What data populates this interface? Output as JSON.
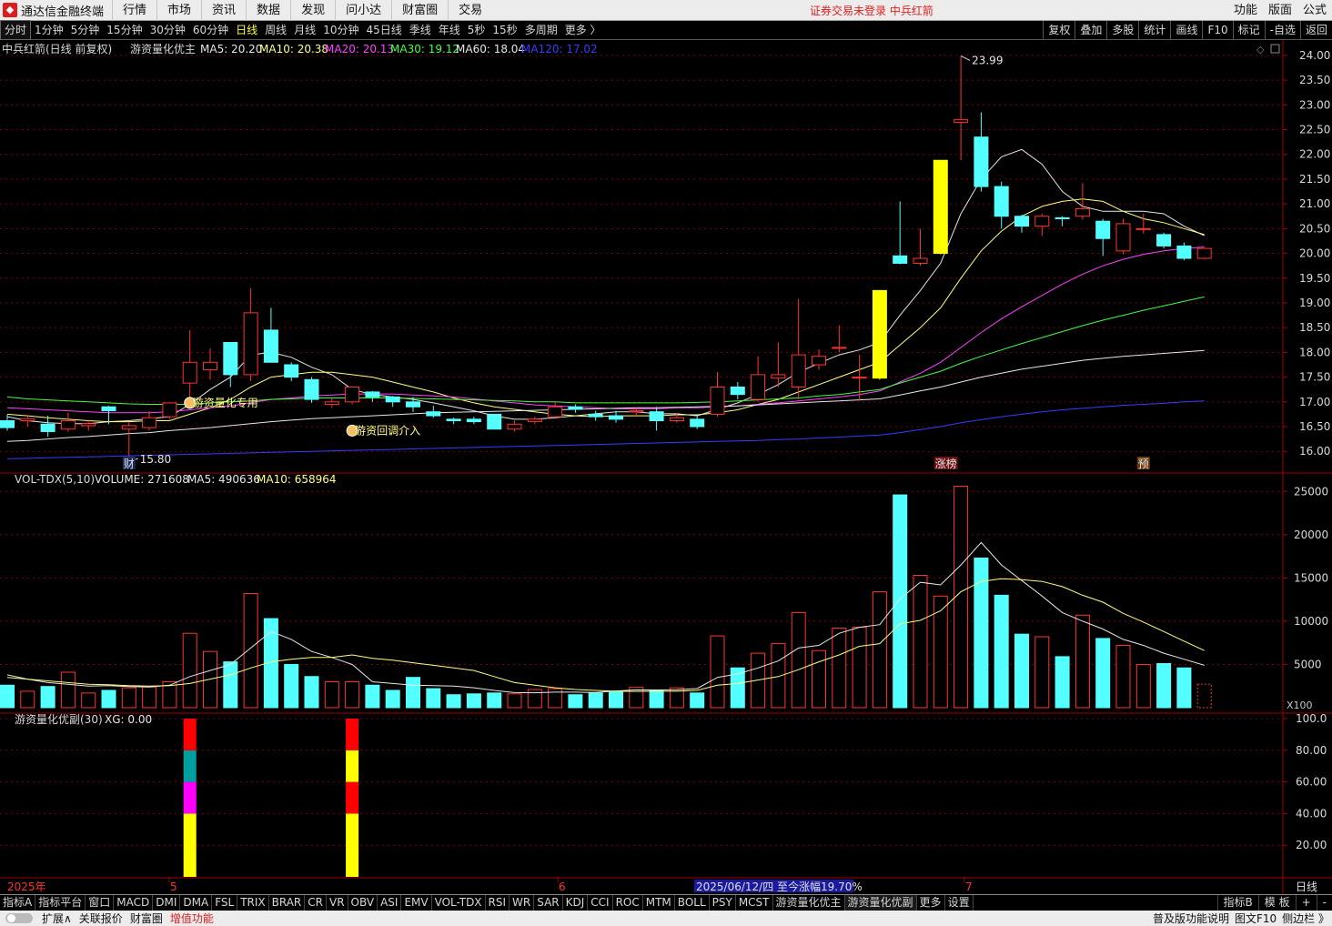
{
  "menubar": {
    "app_title": "通达信金融终端",
    "items": [
      "行情",
      "市场",
      "资讯",
      "数据",
      "发现",
      "问小达",
      "财富圈",
      "交易"
    ],
    "login_warning": "证券交易未登录  中兵红箭",
    "right_items": [
      "功能",
      "版面",
      "公式"
    ]
  },
  "periodbar": {
    "periods": [
      "分时",
      "1分钟",
      "5分钟",
      "15分钟",
      "30分钟",
      "60分钟",
      "日线",
      "周线",
      "月线",
      "10分钟",
      "45日线",
      "季线",
      "年线",
      "5秒",
      "15秒",
      "多周期",
      "更多 〉"
    ],
    "active_index": 6,
    "right_items": [
      "复权",
      "叠加",
      "多股",
      "统计",
      "画线",
      "F10",
      "标记",
      "-自选",
      "返回"
    ]
  },
  "main_panel": {
    "title": "中兵红箭(日线 前复权)",
    "indicator": "游资量化优主",
    "ma": [
      {
        "label": "MA5: 20.20",
        "color": "#e6e6e6"
      },
      {
        "label": "MA10: 20.38",
        "color": "#ffff80"
      },
      {
        "label": "MA20: 20.13",
        "color": "#ff40ff"
      },
      {
        "label": "MA30: 19.12",
        "color": "#40ff40"
      },
      {
        "label": "MA60: 18.04",
        "color": "#e6e6e6"
      },
      {
        "label": "MA120: 17.02",
        "color": "#3a3aff"
      }
    ],
    "annotation_high": "23.99",
    "annotation_low": "15.80",
    "signal_buy": "游资量化专用",
    "signal_pullback": "游资回调介入",
    "marker_cai": "财",
    "marker_zhangbang": "涨榜",
    "marker_yu": "预"
  },
  "vol_panel": {
    "title": "VOL-TDX(5,10)",
    "volume": "VOLUME: 271608",
    "ma5": "MA5: 490636",
    "ma10": "MA10: 658964",
    "unit": "X100"
  },
  "sub_panel": {
    "title": "游资量化优副(30)",
    "xg": "XG: 0.00"
  },
  "xaxis": {
    "labels": [
      "2025年",
      "5",
      "6",
      "7"
    ],
    "hover": "2025/06/12/四  至今涨幅19.70%",
    "period_label": "日线"
  },
  "chart_data": {
    "type": "candlestick",
    "price_axis": {
      "ticks": [
        "24.00",
        "23.50",
        "23.00",
        "22.50",
        "22.00",
        "21.50",
        "21.00",
        "20.50",
        "20.00",
        "19.50",
        "19.00",
        "18.50",
        "18.00",
        "17.50",
        "17.00",
        "16.50",
        "16.00"
      ],
      "range": [
        15.6,
        24.2
      ]
    },
    "volume_axis": {
      "ticks": [
        "25000",
        "20000",
        "15000",
        "10000",
        "5000"
      ],
      "range": [
        0,
        26500
      ]
    },
    "sub_axis": {
      "ticks": [
        "100.0",
        "80.00",
        "60.00",
        "40.00",
        "20.00"
      ],
      "range": [
        0,
        100
      ]
    },
    "candles": [
      {
        "o": 16.62,
        "h": 16.74,
        "c": 16.48,
        "l": 16.42,
        "v": 2600
      },
      {
        "o": 16.62,
        "h": 16.72,
        "c": 16.66,
        "l": 16.5,
        "v": 1900
      },
      {
        "o": 16.55,
        "h": 16.72,
        "c": 16.4,
        "l": 16.3,
        "v": 2450
      },
      {
        "o": 16.45,
        "h": 16.78,
        "c": 16.62,
        "l": 16.4,
        "v": 4100
      },
      {
        "o": 16.52,
        "h": 16.62,
        "c": 16.56,
        "l": 16.42,
        "v": 1700
      },
      {
        "o": 16.9,
        "h": 16.92,
        "c": 16.82,
        "l": 16.55,
        "v": 2000
      },
      {
        "o": 16.45,
        "h": 16.58,
        "c": 16.52,
        "l": 15.8,
        "v": 2300
      },
      {
        "o": 16.48,
        "h": 16.82,
        "c": 16.68,
        "l": 16.42,
        "v": 2400
      },
      {
        "o": 16.7,
        "h": 16.98,
        "c": 16.98,
        "l": 16.65,
        "v": 3000
      },
      {
        "o": 17.38,
        "h": 18.45,
        "c": 17.8,
        "l": 16.9,
        "v": 8600
      },
      {
        "o": 17.65,
        "h": 18.08,
        "c": 17.8,
        "l": 17.45,
        "v": 6500
      },
      {
        "o": 18.2,
        "h": 18.2,
        "c": 17.55,
        "l": 17.3,
        "v": 5300
      },
      {
        "o": 17.55,
        "h": 19.3,
        "c": 18.8,
        "l": 17.42,
        "v": 13200
      },
      {
        "o": 18.45,
        "h": 18.9,
        "c": 17.8,
        "l": 17.8,
        "v": 10300
      },
      {
        "o": 17.75,
        "h": 17.8,
        "c": 17.5,
        "l": 17.42,
        "v": 5000
      },
      {
        "o": 17.45,
        "h": 17.5,
        "c": 17.05,
        "l": 16.98,
        "v": 3600
      },
      {
        "o": 16.95,
        "h": 17.08,
        "c": 17.0,
        "l": 16.88,
        "v": 3000
      },
      {
        "o": 17.0,
        "h": 17.3,
        "c": 17.3,
        "l": 16.95,
        "v": 3000
      },
      {
        "o": 17.2,
        "h": 17.22,
        "c": 17.1,
        "l": 17.0,
        "v": 2600
      },
      {
        "o": 17.1,
        "h": 17.12,
        "c": 17.0,
        "l": 16.9,
        "v": 2000
      },
      {
        "o": 17.0,
        "h": 17.1,
        "c": 16.9,
        "l": 16.8,
        "v": 3500
      },
      {
        "o": 16.8,
        "h": 16.92,
        "c": 16.72,
        "l": 16.68,
        "v": 2200
      },
      {
        "o": 16.65,
        "h": 16.68,
        "c": 16.62,
        "l": 16.55,
        "v": 1500
      },
      {
        "o": 16.65,
        "h": 16.7,
        "c": 16.6,
        "l": 16.55,
        "v": 1600
      },
      {
        "o": 16.75,
        "h": 16.75,
        "c": 16.45,
        "l": 16.45,
        "v": 1700
      },
      {
        "o": 16.45,
        "h": 16.62,
        "c": 16.55,
        "l": 16.4,
        "v": 1600
      },
      {
        "o": 16.6,
        "h": 16.7,
        "c": 16.65,
        "l": 16.55,
        "v": 2100
      },
      {
        "o": 16.7,
        "h": 17.0,
        "c": 16.9,
        "l": 16.7,
        "v": 2200
      },
      {
        "o": 16.9,
        "h": 16.95,
        "c": 16.85,
        "l": 16.78,
        "v": 1500
      },
      {
        "o": 16.75,
        "h": 16.82,
        "c": 16.7,
        "l": 16.62,
        "v": 1700
      },
      {
        "o": 16.72,
        "h": 16.82,
        "c": 16.65,
        "l": 16.58,
        "v": 1800
      },
      {
        "o": 16.8,
        "h": 16.88,
        "c": 16.82,
        "l": 16.7,
        "v": 2350
      },
      {
        "o": 16.8,
        "h": 16.9,
        "c": 16.62,
        "l": 16.42,
        "v": 2000
      },
      {
        "o": 16.62,
        "h": 16.78,
        "c": 16.68,
        "l": 16.58,
        "v": 2300
      },
      {
        "o": 16.65,
        "h": 16.75,
        "c": 16.5,
        "l": 16.45,
        "v": 1700
      },
      {
        "o": 16.75,
        "h": 17.6,
        "c": 17.3,
        "l": 16.7,
        "v": 8300
      },
      {
        "o": 17.3,
        "h": 17.4,
        "c": 17.15,
        "l": 17.05,
        "v": 4600
      },
      {
        "o": 17.05,
        "h": 17.92,
        "c": 17.55,
        "l": 17.0,
        "v": 6300
      },
      {
        "o": 17.48,
        "h": 18.2,
        "c": 17.55,
        "l": 17.3,
        "v": 7400
      },
      {
        "o": 17.3,
        "h": 19.08,
        "c": 17.95,
        "l": 17.05,
        "v": 11000
      },
      {
        "o": 17.75,
        "h": 18.06,
        "c": 17.92,
        "l": 17.65,
        "v": 6600
      },
      {
        "o": 18.1,
        "h": 18.55,
        "c": 18.1,
        "l": 18.0,
        "v": 9200
      },
      {
        "o": 17.48,
        "h": 17.95,
        "c": 17.5,
        "l": 17.02,
        "v": 9300
      },
      {
        "o": 17.48,
        "h": 19.25,
        "c": 19.25,
        "l": 17.45,
        "v": 13400,
        "limit": true
      },
      {
        "o": 19.95,
        "h": 21.05,
        "c": 19.8,
        "l": 19.78,
        "v": 24600
      },
      {
        "o": 19.8,
        "h": 20.5,
        "c": 19.9,
        "l": 19.75,
        "v": 15300
      },
      {
        "o": 20.0,
        "h": 21.88,
        "c": 21.88,
        "l": 19.98,
        "v": 12900,
        "limit": true
      },
      {
        "o": 22.65,
        "h": 23.99,
        "c": 22.7,
        "l": 21.88,
        "v": 25600
      },
      {
        "o": 22.35,
        "h": 22.85,
        "c": 21.35,
        "l": 21.25,
        "v": 17300
      },
      {
        "o": 21.35,
        "h": 21.45,
        "c": 20.75,
        "l": 20.5,
        "v": 13000
      },
      {
        "o": 20.75,
        "h": 20.78,
        "c": 20.55,
        "l": 20.42,
        "v": 8500
      },
      {
        "o": 20.55,
        "h": 20.8,
        "c": 20.75,
        "l": 20.35,
        "v": 8200
      },
      {
        "o": 20.72,
        "h": 20.75,
        "c": 20.7,
        "l": 20.55,
        "v": 5900
      },
      {
        "o": 20.75,
        "h": 21.42,
        "c": 20.9,
        "l": 20.68,
        "v": 10700
      },
      {
        "o": 20.65,
        "h": 20.7,
        "c": 20.3,
        "l": 19.95,
        "v": 8000
      },
      {
        "o": 20.05,
        "h": 20.7,
        "c": 20.6,
        "l": 19.98,
        "v": 7200
      },
      {
        "o": 20.5,
        "h": 20.8,
        "c": 20.5,
        "l": 20.4,
        "v": 5000
      },
      {
        "o": 20.38,
        "h": 20.42,
        "c": 20.15,
        "l": 20.1,
        "v": 5100
      },
      {
        "o": 20.15,
        "h": 20.22,
        "c": 19.9,
        "l": 19.86,
        "v": 4600
      },
      {
        "o": 19.9,
        "h": 20.1,
        "c": 20.1,
        "l": 19.88,
        "v": 2716
      }
    ],
    "ma_lines": {
      "MA5": [
        16.7,
        16.62,
        16.58,
        16.56,
        16.56,
        16.6,
        16.62,
        16.66,
        16.7,
        16.95,
        17.25,
        17.5,
        17.95,
        18.0,
        17.9,
        17.7,
        17.55,
        17.25,
        17.15,
        17.1,
        17.05,
        16.98,
        16.9,
        16.82,
        16.72,
        16.65,
        16.65,
        16.68,
        16.72,
        16.76,
        16.8,
        16.8,
        16.76,
        16.76,
        16.72,
        16.85,
        16.98,
        17.15,
        17.35,
        17.6,
        17.78,
        17.95,
        18.05,
        18.2,
        18.75,
        19.25,
        19.8,
        20.8,
        21.5,
        21.95,
        22.1,
        21.8,
        21.25,
        20.95,
        20.85,
        20.85,
        20.85,
        20.8,
        20.55,
        20.36
      ],
      "MA10": [
        16.75,
        16.72,
        16.68,
        16.65,
        16.62,
        16.6,
        16.6,
        16.62,
        16.62,
        16.75,
        16.88,
        17.05,
        17.3,
        17.5,
        17.55,
        17.6,
        17.6,
        17.55,
        17.5,
        17.4,
        17.3,
        17.2,
        17.08,
        16.98,
        16.9,
        16.85,
        16.8,
        16.75,
        16.72,
        16.7,
        16.72,
        16.72,
        16.72,
        16.74,
        16.74,
        16.78,
        16.84,
        16.95,
        17.05,
        17.2,
        17.35,
        17.5,
        17.65,
        17.8,
        18.15,
        18.5,
        18.9,
        19.5,
        20.05,
        20.45,
        20.75,
        20.95,
        21.05,
        21.1,
        21.05,
        20.85,
        20.7,
        20.62,
        20.5,
        20.38
      ],
      "MA20": [
        16.88,
        16.86,
        16.84,
        16.82,
        16.8,
        16.78,
        16.78,
        16.78,
        16.8,
        16.84,
        16.88,
        16.92,
        16.98,
        17.05,
        17.08,
        17.12,
        17.14,
        17.16,
        17.16,
        17.16,
        17.14,
        17.12,
        17.1,
        17.06,
        17.02,
        16.98,
        16.94,
        16.92,
        16.9,
        16.88,
        16.86,
        16.86,
        16.86,
        16.88,
        16.88,
        16.9,
        16.92,
        16.95,
        16.98,
        17.02,
        17.06,
        17.1,
        17.15,
        17.22,
        17.4,
        17.58,
        17.8,
        18.1,
        18.4,
        18.68,
        18.92,
        19.15,
        19.38,
        19.58,
        19.75,
        19.88,
        19.98,
        20.05,
        20.1,
        20.13
      ],
      "MA30": [
        17.1,
        17.06,
        17.04,
        17.02,
        17.0,
        16.98,
        16.96,
        16.95,
        16.95,
        16.95,
        16.98,
        17.0,
        17.02,
        17.05,
        17.06,
        17.08,
        17.08,
        17.08,
        17.08,
        17.08,
        17.07,
        17.06,
        17.05,
        17.04,
        17.03,
        17.02,
        17.0,
        17.0,
        16.98,
        16.98,
        16.98,
        16.98,
        16.98,
        16.98,
        16.99,
        17.0,
        17.02,
        17.04,
        17.06,
        17.08,
        17.12,
        17.15,
        17.2,
        17.25,
        17.38,
        17.5,
        17.62,
        17.78,
        17.92,
        18.05,
        18.18,
        18.3,
        18.42,
        18.54,
        18.65,
        18.75,
        18.85,
        18.94,
        19.03,
        19.12
      ],
      "MA60": [
        16.2,
        16.22,
        16.25,
        16.28,
        16.3,
        16.33,
        16.36,
        16.38,
        16.42,
        16.45,
        16.48,
        16.52,
        16.56,
        16.6,
        16.63,
        16.66,
        16.68,
        16.7,
        16.72,
        16.74,
        16.76,
        16.78,
        16.79,
        16.8,
        16.81,
        16.82,
        16.83,
        16.84,
        16.85,
        16.86,
        16.87,
        16.88,
        16.88,
        16.89,
        16.9,
        16.91,
        16.92,
        16.94,
        16.96,
        16.98,
        17.0,
        17.02,
        17.04,
        17.06,
        17.14,
        17.22,
        17.3,
        17.4,
        17.5,
        17.58,
        17.66,
        17.72,
        17.78,
        17.84,
        17.88,
        17.92,
        17.95,
        17.98,
        18.01,
        18.04
      ],
      "MA120": [
        15.85,
        15.86,
        15.87,
        15.88,
        15.89,
        15.9,
        15.91,
        15.92,
        15.93,
        15.94,
        15.95,
        15.96,
        15.97,
        15.98,
        15.99,
        16.0,
        16.01,
        16.02,
        16.03,
        16.04,
        16.05,
        16.06,
        16.07,
        16.08,
        16.09,
        16.1,
        16.11,
        16.12,
        16.13,
        16.14,
        16.15,
        16.16,
        16.17,
        16.18,
        16.19,
        16.2,
        16.21,
        16.22,
        16.24,
        16.25,
        16.27,
        16.29,
        16.31,
        16.33,
        16.38,
        16.44,
        16.5,
        16.58,
        16.64,
        16.7,
        16.75,
        16.8,
        16.84,
        16.87,
        16.9,
        16.93,
        16.95,
        16.97,
        17.0,
        17.02
      ]
    },
    "vol_ma": {
      "MA5": [
        3800,
        3300,
        2900,
        2700,
        2500,
        2550,
        2450,
        2400,
        2600,
        3600,
        4300,
        5000,
        6900,
        8800,
        7900,
        6500,
        5800,
        5000,
        3000,
        2800,
        2600,
        2550,
        2500,
        2300,
        2000,
        1750,
        1720,
        1800,
        1800,
        1760,
        1940,
        2060,
        2050,
        2070,
        2210,
        3500,
        3900,
        4600,
        5400,
        6900,
        7200,
        8600,
        9300,
        9600,
        12600,
        14500,
        14200,
        16500,
        19100,
        16500,
        14700,
        12900,
        11000,
        10000,
        9100,
        7900,
        7200,
        6300,
        5600,
        4900
      ],
      "MA10": [
        3500,
        3300,
        3100,
        2900,
        2700,
        2650,
        2550,
        2500,
        2550,
        2800,
        3300,
        3800,
        4600,
        5300,
        5600,
        5800,
        5800,
        6100,
        5700,
        5500,
        5200,
        4900,
        4600,
        4300,
        3600,
        2900,
        2600,
        2300,
        2100,
        2000,
        1900,
        1880,
        1900,
        1900,
        2000,
        2600,
        2800,
        3200,
        3600,
        4400,
        5300,
        6100,
        7100,
        7400,
        9700,
        10100,
        11200,
        13400,
        14600,
        14900,
        14800,
        14600,
        14000,
        13000,
        12200,
        10900,
        9900,
        8800,
        7700,
        6600
      ]
    },
    "sub_signals": [
      {
        "index": 9,
        "segments": [
          {
            "from": 0,
            "to": 40,
            "color": "#ffff00"
          },
          {
            "from": 40,
            "to": 60,
            "color": "#ff00ff"
          },
          {
            "from": 60,
            "to": 80,
            "color": "#00a0a0"
          },
          {
            "from": 80,
            "to": 100,
            "color": "#ff0000"
          }
        ]
      },
      {
        "index": 17,
        "segments": [
          {
            "from": 0,
            "to": 40,
            "color": "#ffff00"
          },
          {
            "from": 40,
            "to": 60,
            "color": "#ff0000"
          },
          {
            "from": 60,
            "to": 80,
            "color": "#ffff00"
          },
          {
            "from": 80,
            "to": 100,
            "color": "#ff0000"
          }
        ]
      }
    ]
  },
  "tabbar": {
    "tabs": [
      "指标A",
      "指标平台",
      "窗口",
      "MACD",
      "DMI",
      "DMA",
      "FSL",
      "TRIX",
      "BRAR",
      "CR",
      "VR",
      "OBV",
      "ASI",
      "EMV",
      "VOL-TDX",
      "RSI",
      "WR",
      "SAR",
      "KDJ",
      "CCI",
      "ROC",
      "MTM",
      "BOLL",
      "PSY",
      "MCST",
      "游资量化优主",
      "游资量化优副",
      "更多",
      "设置"
    ],
    "active_index": 26,
    "right": [
      "指标B",
      "模 板",
      "+",
      "-"
    ]
  },
  "statusbar": {
    "items": [
      "扩展∧",
      "关联报价",
      "财富圈"
    ],
    "accent_item": "增值功能",
    "right": [
      "普及版功能说明",
      "图文F10",
      "侧边栏 》"
    ]
  },
  "colors": {
    "up": "#ff3232",
    "down": "#54ffff",
    "limit": "#ffff00",
    "grid": "#7a0000"
  }
}
